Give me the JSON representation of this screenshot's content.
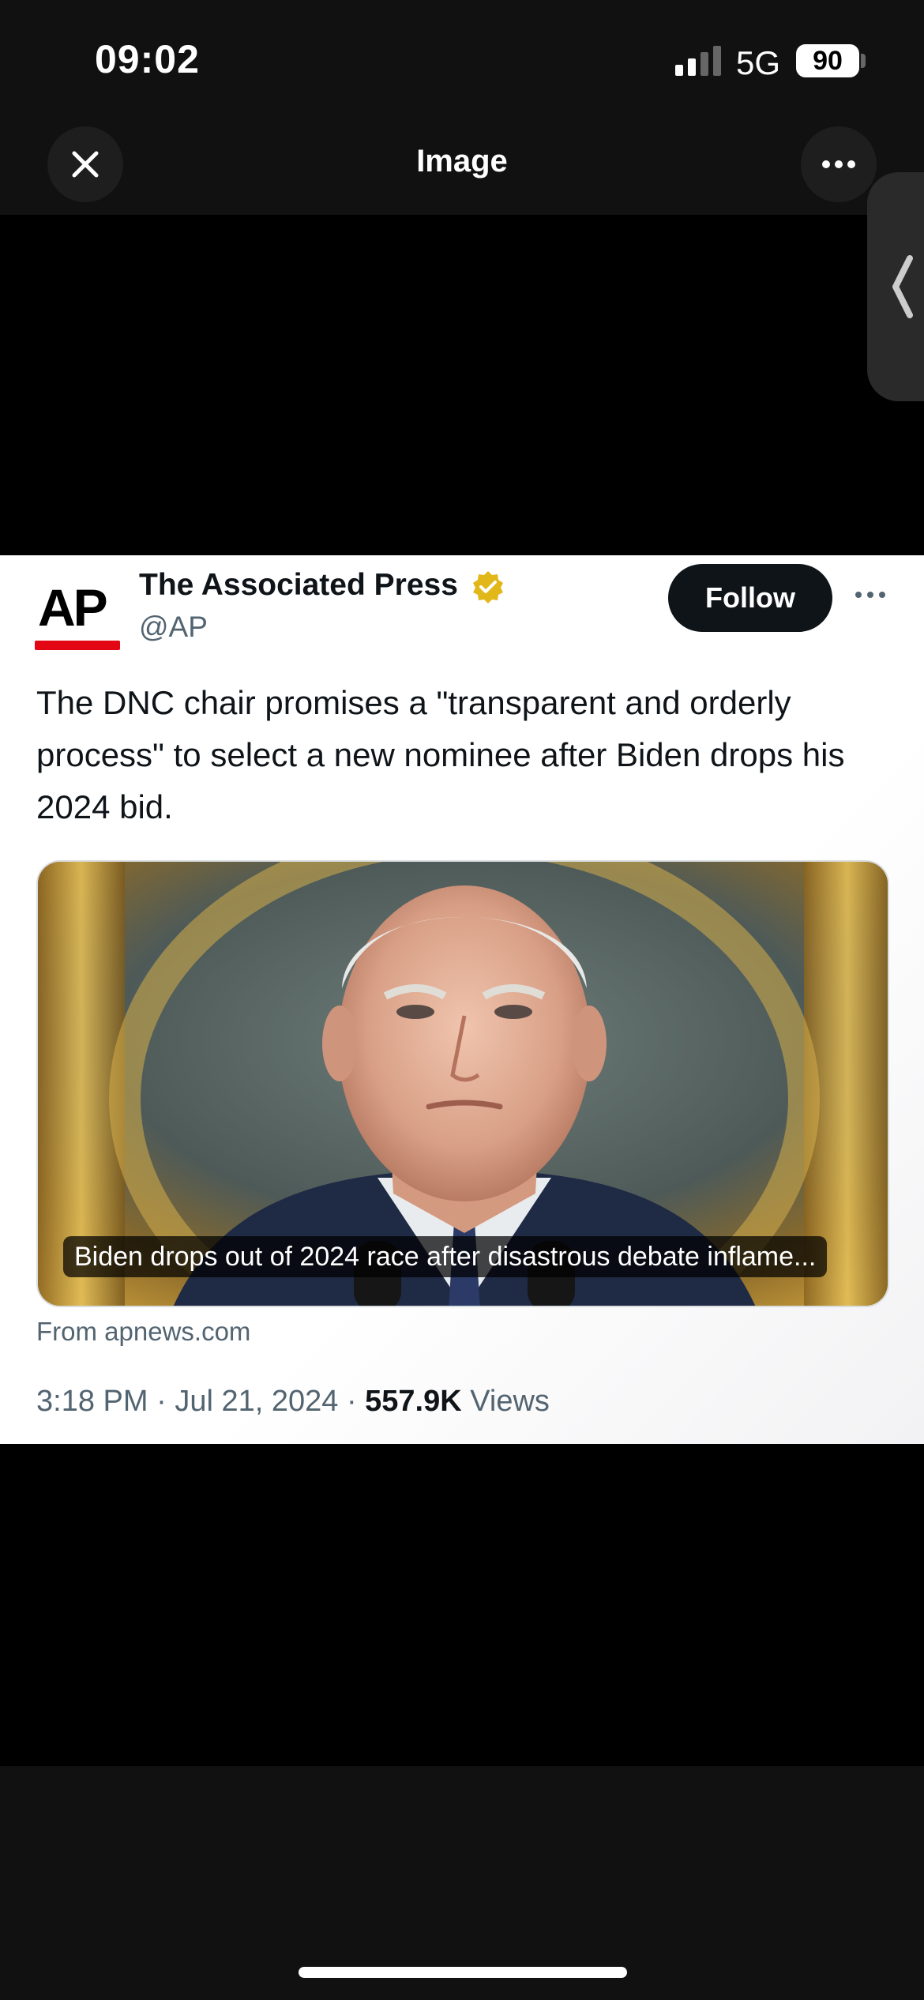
{
  "status_bar": {
    "time": "09:02",
    "network": "5G",
    "battery": "90"
  },
  "nav": {
    "title": "Image",
    "close_icon": "close-icon",
    "more_icon": "more-horizontal-icon"
  },
  "tweet": {
    "avatar_text": "AP",
    "display_name": "The Associated Press",
    "handle": "@AP",
    "verified_badge_color": "#e2b719",
    "follow_label": "Follow",
    "text": "The DNC chair promises a \"transparent and orderly process\" to select a new nominee after Biden drops his 2024 bid.",
    "link_card": {
      "caption": "Biden drops out of 2024 race after disastrous debate inflame...",
      "source": "From apnews.com"
    },
    "time": "3:18 PM",
    "date": "Jul 21, 2024",
    "views_count": "557.9K",
    "views_label": "Views"
  },
  "colors": {
    "brand_red": "#e30613",
    "text_primary": "#0f1419",
    "text_secondary": "#536471"
  }
}
